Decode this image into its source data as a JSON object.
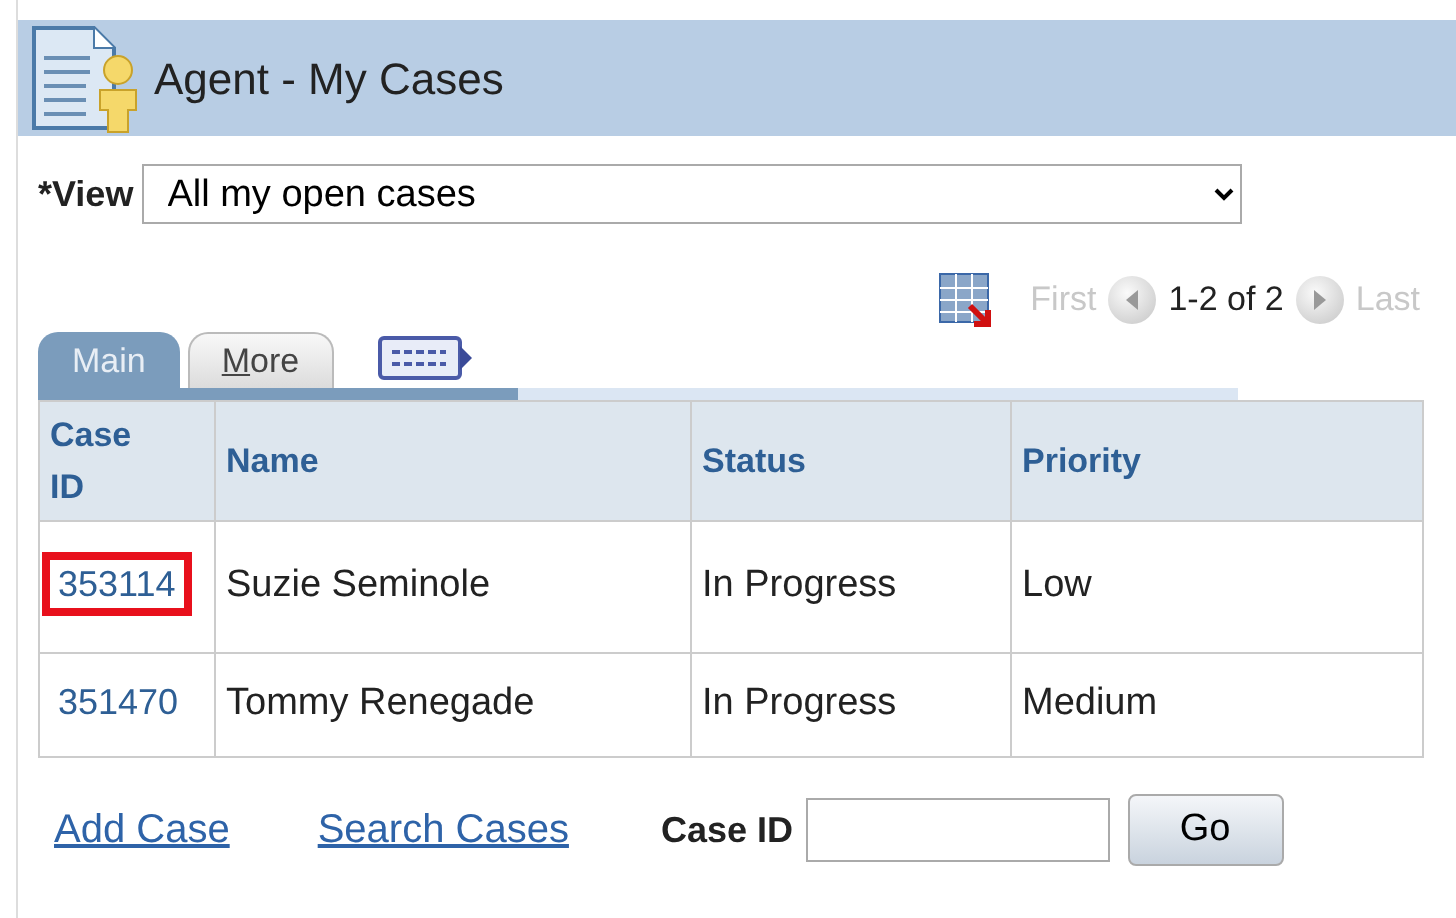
{
  "header": {
    "title": "Agent - My Cases"
  },
  "view": {
    "label": "*View",
    "value": "All my open cases"
  },
  "pager": {
    "first": "First",
    "range": "1-2 of 2",
    "last": "Last",
    "first_disabled": true,
    "last_disabled": true
  },
  "tabs": [
    {
      "label": "Main",
      "selected": true
    },
    {
      "label": "More",
      "selected": false,
      "first_letter_underlined": true
    }
  ],
  "table": {
    "columns": [
      "Case ID",
      "Name",
      "Status",
      "Priority"
    ],
    "rows": [
      {
        "case_id": "353114",
        "name": "Suzie Seminole",
        "status": "In Progress",
        "priority": "Low",
        "highlighted": true
      },
      {
        "case_id": "351470",
        "name": "Tommy Renegade",
        "status": "In Progress",
        "priority": "Medium",
        "highlighted": false
      }
    ]
  },
  "footer": {
    "links": [
      "Add Case",
      "Search Cases"
    ],
    "field_label": "Case ID",
    "button": "Go"
  }
}
